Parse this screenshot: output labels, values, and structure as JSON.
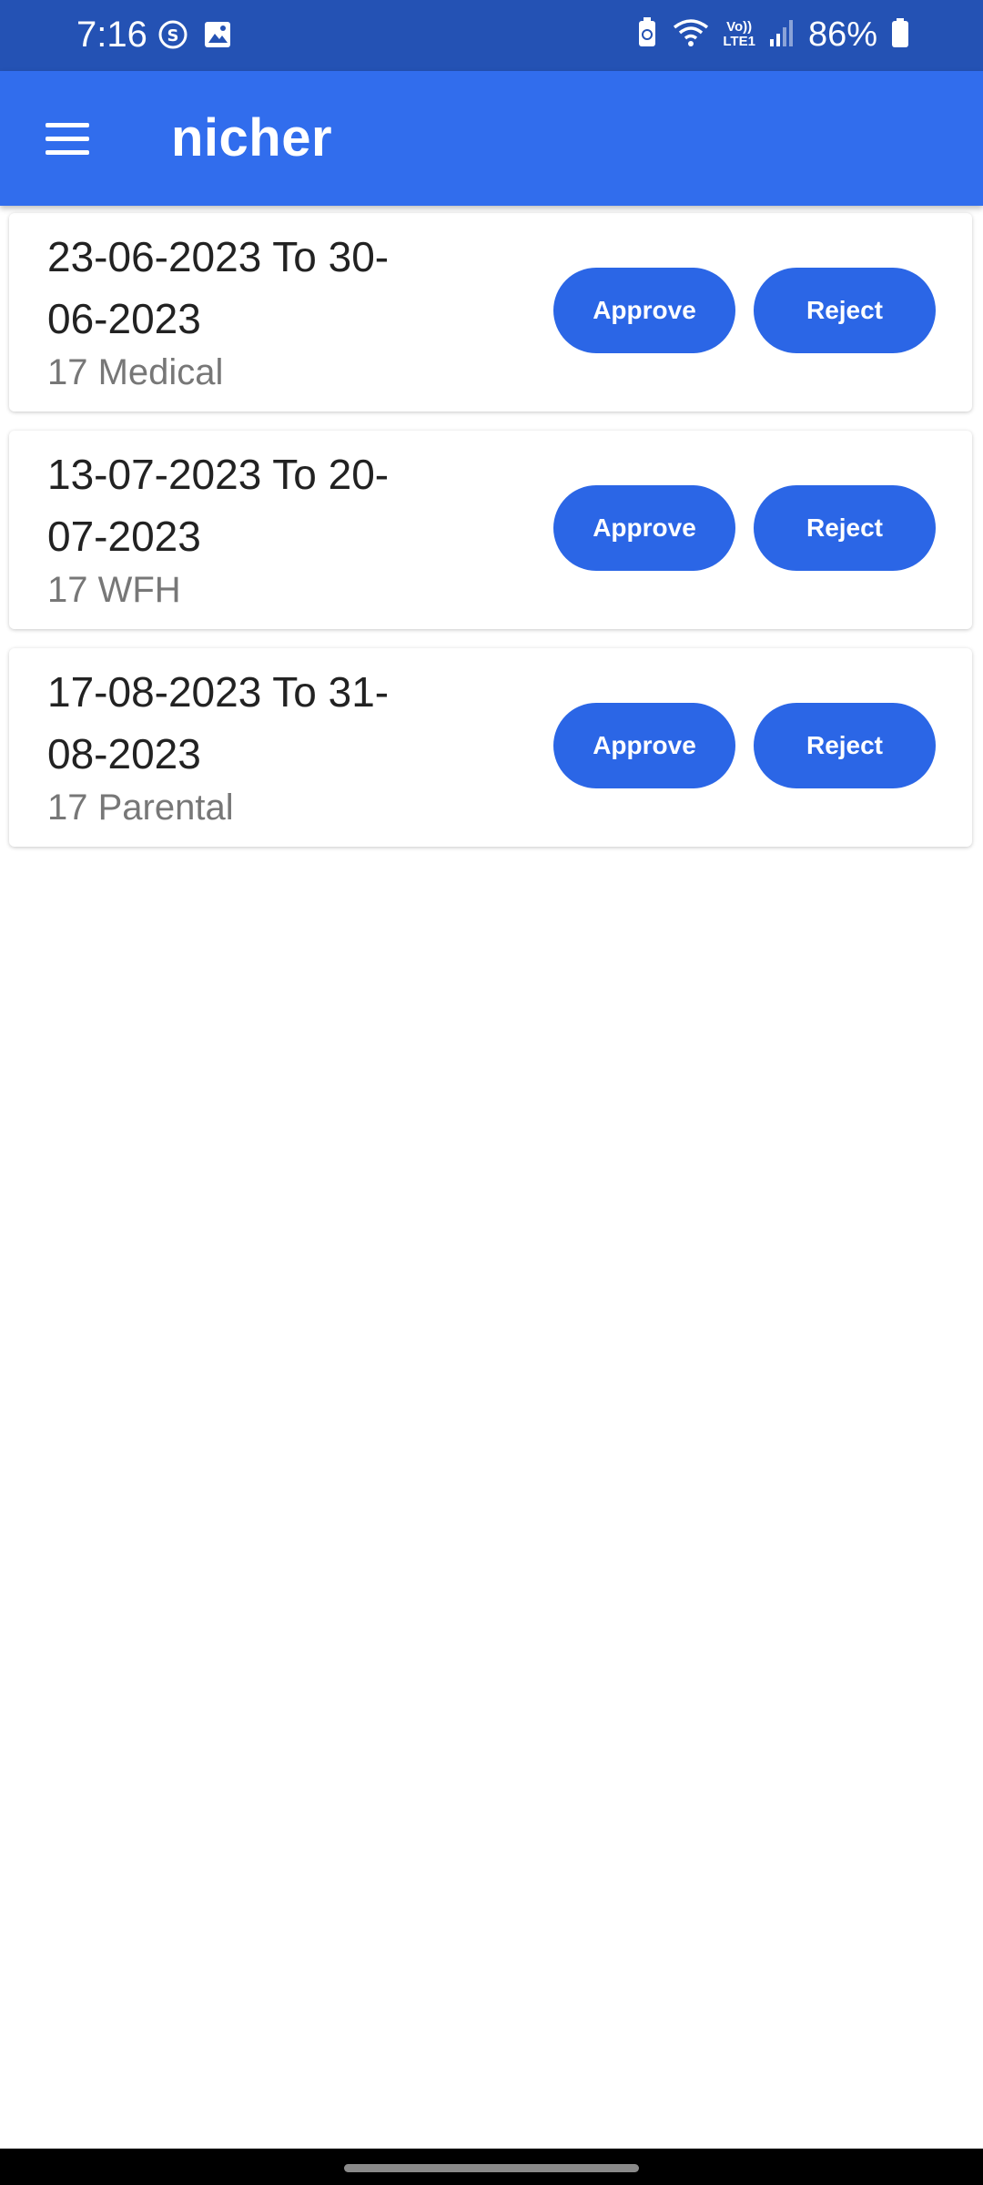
{
  "status_bar": {
    "time": "7:16",
    "volte_top": "Vo))",
    "volte_bottom": "LTE1",
    "battery": "86%",
    "icons": [
      "sync-icon",
      "gallery-icon",
      "battery-saver-icon",
      "wifi-icon",
      "signal-icon",
      "battery-icon"
    ]
  },
  "app_bar": {
    "title": "nicher",
    "menu_icon": "hamburger-menu-icon"
  },
  "colors": {
    "status_bar": "#2452b4",
    "app_bar": "#316ded",
    "button": "#2b66e6",
    "primary_text": "#222222",
    "secondary_text": "#777777"
  },
  "requests": [
    {
      "date_range": "23-06-2023 To 30-06-2023",
      "type": "17 Medical",
      "approve_label": "Approve",
      "reject_label": "Reject"
    },
    {
      "date_range": "13-07-2023 To 20-07-2023",
      "type": "17 WFH",
      "approve_label": "Approve",
      "reject_label": "Reject"
    },
    {
      "date_range": "17-08-2023 To 31-08-2023",
      "type": "17 Parental",
      "approve_label": "Approve",
      "reject_label": "Reject"
    }
  ]
}
